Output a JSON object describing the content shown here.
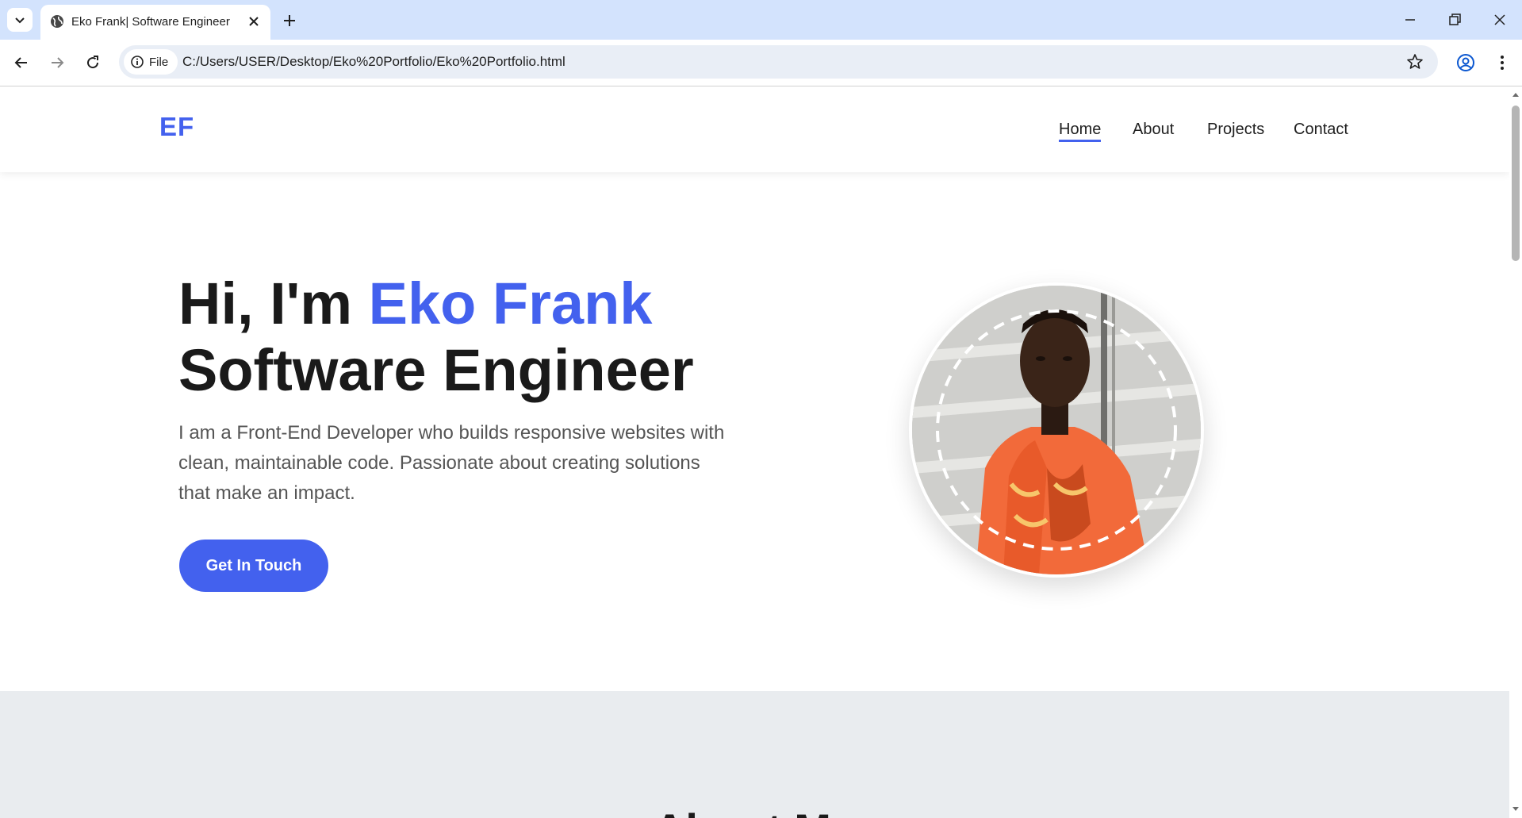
{
  "browser": {
    "tab_title": "Eko Frank| Software Engineer",
    "site_info_label": "File",
    "url": "C:/Users/USER/Desktop/Eko%20Portfolio/Eko%20Portfolio.html"
  },
  "header": {
    "logo": "EF",
    "nav": [
      {
        "label": "Home",
        "active": true
      },
      {
        "label": "About",
        "active": false
      },
      {
        "label": "Projects",
        "active": false
      },
      {
        "label": "Contact",
        "active": false
      }
    ]
  },
  "hero": {
    "greeting": "Hi, I'm",
    "name": "Eko Frank",
    "role": "Software Engineer",
    "description": "I am a Front-End Developer who builds responsive websites with clean, maintainable code. Passionate about creating solutions that make an impact.",
    "cta_label": "Get In Touch"
  },
  "about": {
    "title": "About Me"
  },
  "colors": {
    "accent": "#4361ee",
    "tabbar": "#d3e3fd",
    "section_gray": "#e9ecef",
    "shirt": "#f26a3a"
  },
  "icons": [
    "tab-search-icon",
    "globe-icon",
    "close-icon",
    "plus-icon",
    "minimize-icon",
    "restore-icon",
    "back-arrow-icon",
    "forward-arrow-icon",
    "reload-icon",
    "info-icon",
    "star-icon",
    "profile-icon",
    "kebab-menu-icon"
  ]
}
